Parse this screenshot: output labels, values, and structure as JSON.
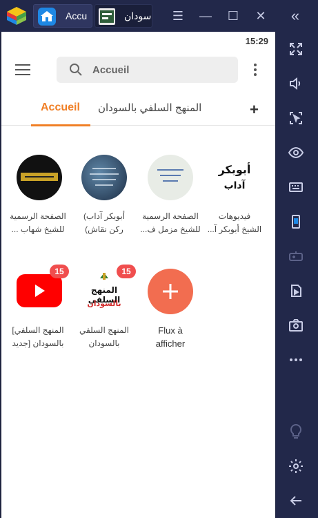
{
  "window": {
    "tabs": [
      {
        "label": "Accu"
      },
      {
        "label": "سودان"
      }
    ],
    "controls": [
      "menu",
      "minimize",
      "maximize",
      "close"
    ],
    "collapse_label": "«"
  },
  "status": {
    "time": "15:29"
  },
  "toolbar": {
    "search_text": "Accueil"
  },
  "tabs": [
    {
      "label": "Accueil",
      "active": true
    },
    {
      "label": "المنهج السلفي بالسودان",
      "active": false
    }
  ],
  "feeds": [
    {
      "label_line1": "فيديوهات",
      "label_line2": "الشيخ أبوبكر آ...",
      "thumb_text_1": "أبوبكر",
      "thumb_text_2": "آداب"
    },
    {
      "label_line1": "الصفحة الرسمية",
      "label_line2": "للشيخ مزمل ف..."
    },
    {
      "label_line1": "أبوبكر آداب)",
      "label_line2": "ركن نقاش)"
    },
    {
      "label_line1": "الصفحة الرسمية",
      "label_line2": "للشيخ شهاب ..."
    },
    {
      "label_line1": "Flux à",
      "label_line2": "afficher"
    },
    {
      "label_line1": "المنهج السلفي",
      "label_line2": "بالسودان",
      "badge": "15",
      "thumb_text_1": "المنهج السلفي",
      "thumb_text_2": "بالسودان"
    },
    {
      "label_line1": "المنهج السلفي]",
      "label_line2": "بالسودان [جديد",
      "badge": "15"
    }
  ],
  "colors": {
    "accent": "#f07f26",
    "add_button": "#f26d50",
    "badge": "#f04e4e",
    "youtube": "#ff0000"
  }
}
